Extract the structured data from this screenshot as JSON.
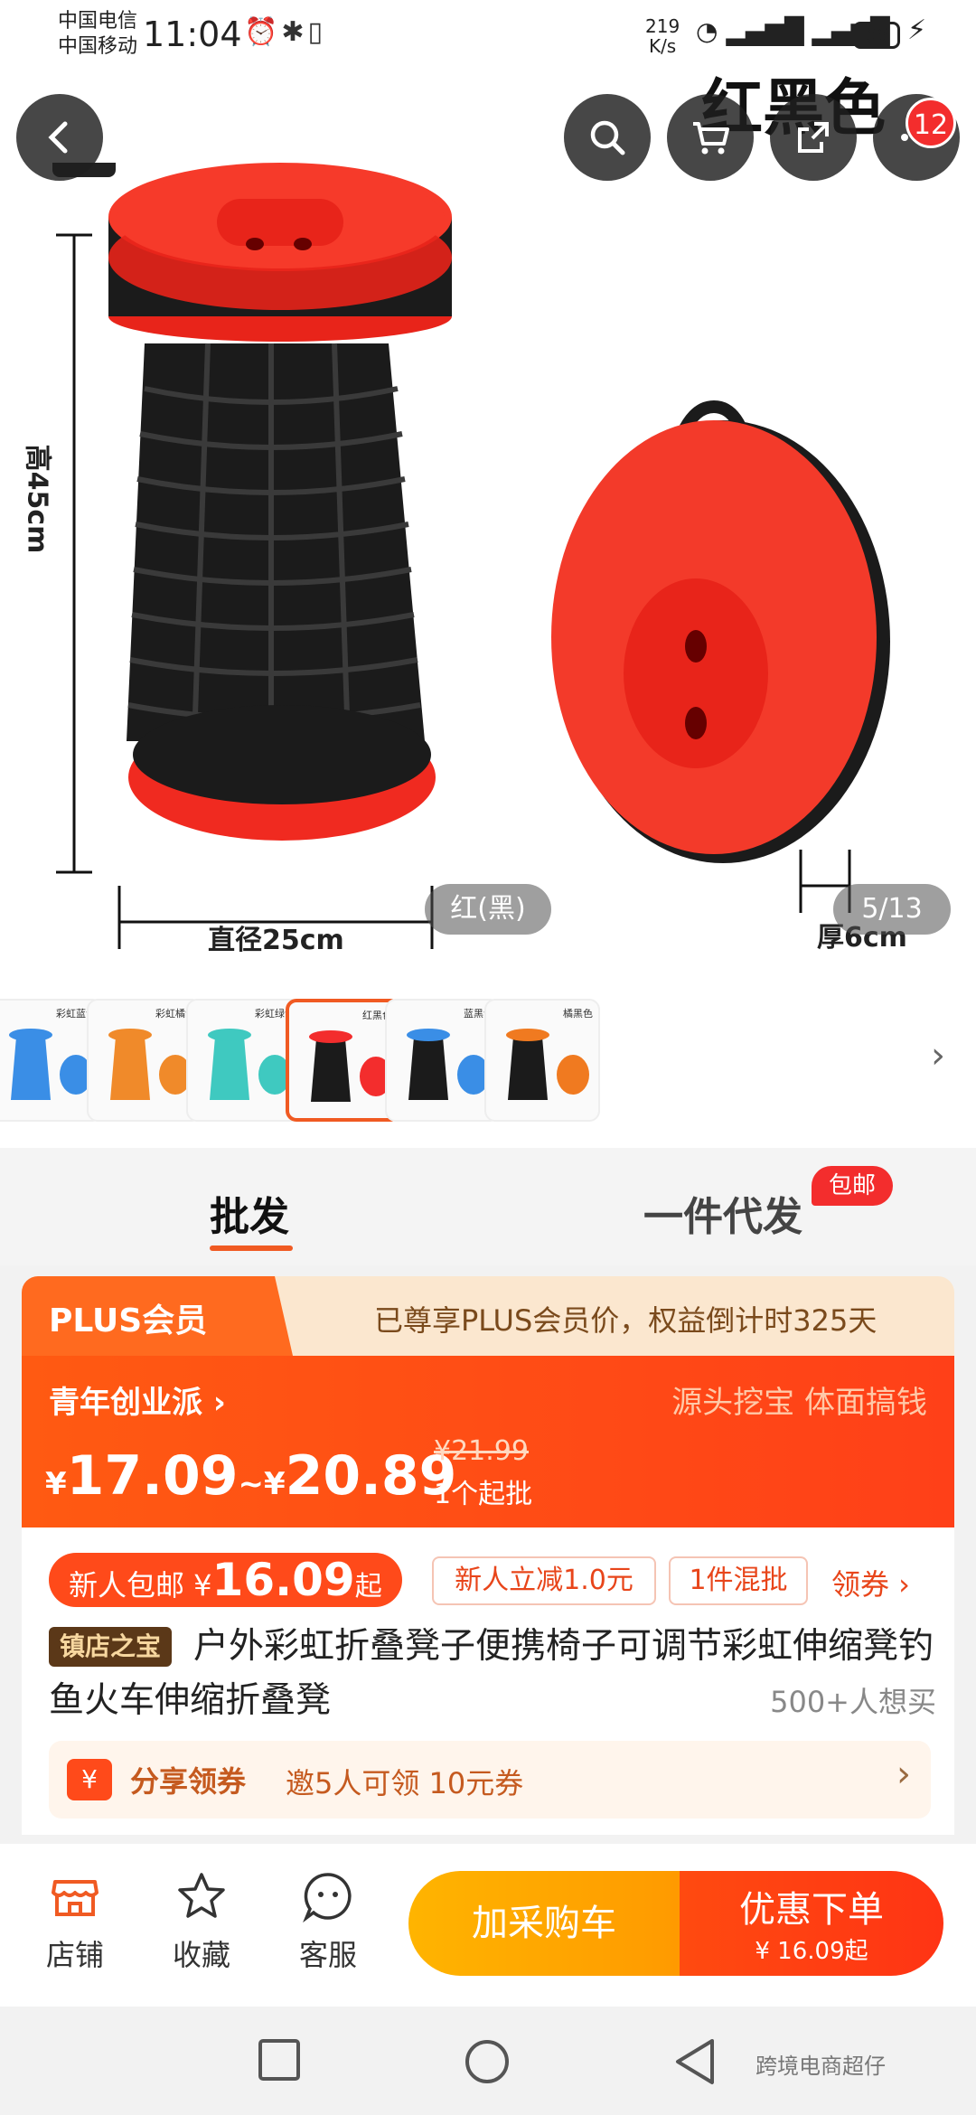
{
  "status_bar": {
    "carrier_1": "中国电信",
    "carrier_2": "中国移动",
    "time": "11:04",
    "net_speed_value": "219",
    "net_speed_unit": "K/s",
    "battery": "66"
  },
  "header": {
    "variant_title": "红黑色",
    "cart_badge": "12",
    "icons": [
      "back-icon",
      "search-icon",
      "cart-icon",
      "share-icon",
      "more-icon"
    ]
  },
  "hero": {
    "height_label": "高45cm",
    "diameter_label": "直径25cm",
    "thickness_label": "厚6cm",
    "color_pill": "红(黑)",
    "page_indicator": "5/13"
  },
  "thumbnails": [
    {
      "name": "彩虹蓝色",
      "color": "#3a8ee6",
      "selected": false
    },
    {
      "name": "彩虹橘色",
      "color": "#f08a2a",
      "selected": false
    },
    {
      "name": "彩虹绿色",
      "color": "#3fc9c0",
      "selected": false
    },
    {
      "name": "红黑色",
      "color": "#f32d2d",
      "selected": true
    },
    {
      "name": "蓝黑色",
      "color": "#3a8ee6",
      "selected": false
    },
    {
      "name": "橘黑色",
      "color": "#f07a20",
      "selected": false
    }
  ],
  "tabs": {
    "wholesale": "批发",
    "dropship": "一件代发",
    "dropship_badge": "包邮"
  },
  "plus": {
    "label": "PLUS会员",
    "text": "已尊享PLUS会员价，权益倒计时325天"
  },
  "price": {
    "tag": "青年创业派",
    "slogan": "源头挖宝 体面搞钱",
    "yen": "¥",
    "low": "17.09",
    "separator": "~",
    "high": "20.89",
    "original": "¥21.99",
    "moq": "1个起批"
  },
  "promo": {
    "new_user_prefix": "新人包邮 ¥",
    "new_user_price": "16.09",
    "new_user_suffix": "起",
    "chip_1": "新人立减1.0元",
    "chip_2": "1件混批",
    "coupon": "领券 ›"
  },
  "product": {
    "store_badge": "镇店之宝",
    "title": "户外彩虹折叠凳子便携椅子可调节彩虹伸缩凳钓鱼火车伸缩折叠凳",
    "want_count": "500+人想买"
  },
  "share": {
    "icon": "¥",
    "label": "分享领券",
    "text": "邀5人可领 10元券"
  },
  "actions": {
    "store": "店铺",
    "favorite": "收藏",
    "service": "客服",
    "add_cart": "加采购车",
    "buy": "优惠下单",
    "buy_price": "¥ 16.09起"
  },
  "watermark": "跨境电商超仔"
}
